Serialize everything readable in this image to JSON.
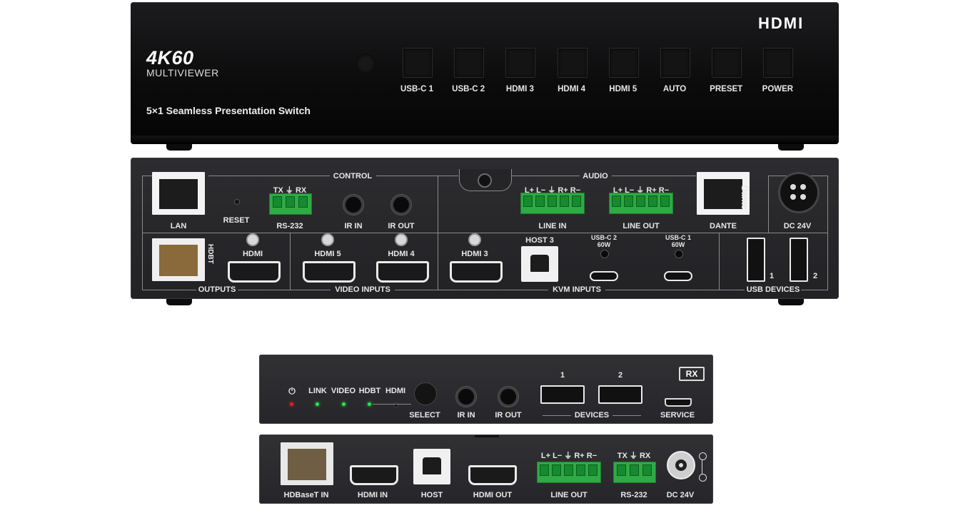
{
  "front_panel": {
    "brand_logo": "HDMI",
    "model_title": "4K60",
    "model_subtitle": "MULTIVIEWER",
    "tagline": "5×1 Seamless Presentation Switch",
    "buttons": [
      "USB-C 1",
      "USB-C 2",
      "HDMI 3",
      "HDMI 4",
      "HDMI 5",
      "AUTO",
      "PRESET",
      "POWER"
    ]
  },
  "rear_panel": {
    "section_control": "CONTROL",
    "section_audio": "AUDIO",
    "section_outputs": "OUTPUTS",
    "section_video_inputs": "VIDEO INPUTS",
    "section_kvm_inputs": "KVM INPUTS",
    "section_usb_devices": "USB DEVICES",
    "lan": "LAN",
    "reset": "RESET",
    "rs232_pins": "TX  ⏚  RX",
    "rs232": "RS-232",
    "ir_in": "IR IN",
    "ir_out": "IR OUT",
    "audio_pins": "L+ L−  ⏚  R+ R−",
    "line_in": "LINE IN",
    "line_out": "LINE OUT",
    "dante": "DANTE",
    "dante_logo": "Dante",
    "dc": "DC 24V",
    "hdbt": "HDBT",
    "hdmi_out": "HDMI",
    "hdmi5": "HDMI 5",
    "hdmi4": "HDMI 4",
    "hdmi3": "HDMI 3",
    "host3": "HOST 3",
    "usbc2": "USB-C 2",
    "usbc1": "USB-C 1",
    "watt": "60W",
    "usb_num1": "1",
    "usb_num2": "2"
  },
  "receiver_front": {
    "power_icon": "⏻",
    "link": "LINK",
    "video": "VIDEO",
    "hdbt": "HDBT",
    "hdmi": "HDMI",
    "select": "SELECT",
    "ir_in": "IR IN",
    "ir_out": "IR OUT",
    "dev1": "1",
    "dev2": "2",
    "devices": "DEVICES",
    "rx_badge": "RX",
    "service": "SERVICE"
  },
  "receiver_rear": {
    "hdbaset_in": "HDBaseT IN",
    "hdmi_in": "HDMI IN",
    "host": "HOST",
    "hdmi_out": "HDMI OUT",
    "audio_pins": "L+ L−  ⏚  R+ R−",
    "line_out": "LINE OUT",
    "rs232_pins": "TX  ⏚  RX",
    "rs232": "RS-232",
    "dc": "DC 24V"
  },
  "colors": {
    "chassis": "#2a2a2d",
    "front_glass": "#0b0b0c",
    "terminal_green": "#2faa45",
    "led_red": "#e02020",
    "led_green": "#2ee04a"
  }
}
